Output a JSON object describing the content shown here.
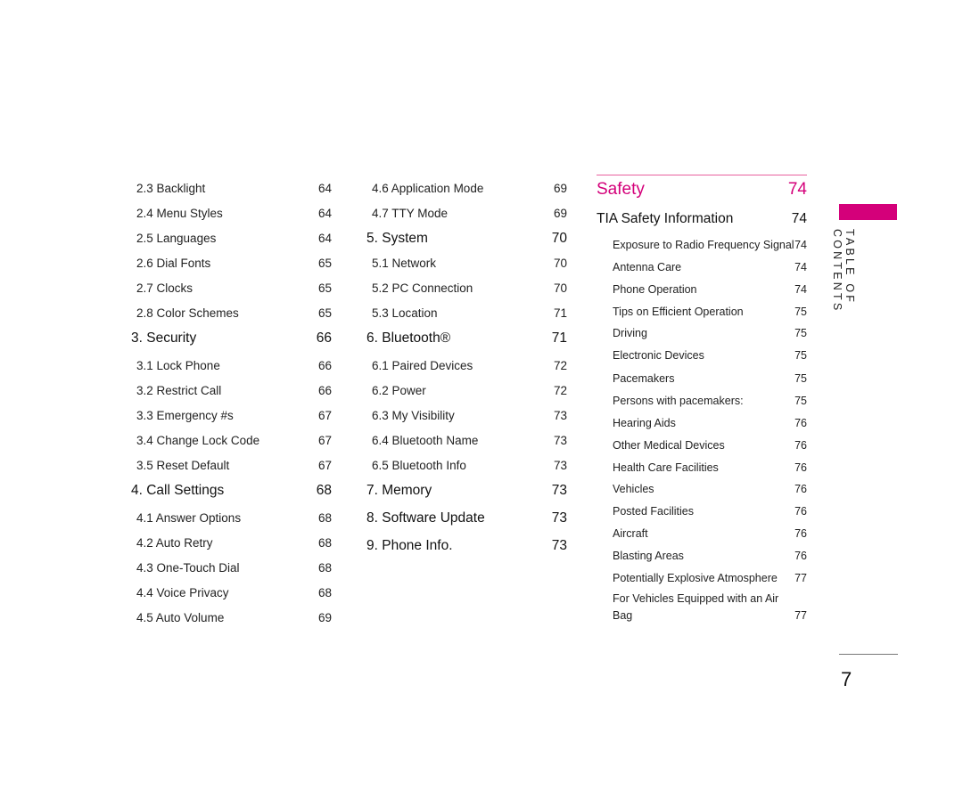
{
  "column1": [
    {
      "label": "2.3 Backlight",
      "page": "64",
      "level": "sub"
    },
    {
      "label": "2.4 Menu Styles",
      "page": "64",
      "level": "sub"
    },
    {
      "label": "2.5 Languages",
      "page": "64",
      "level": "sub"
    },
    {
      "label": "2.6 Dial Fonts",
      "page": "65",
      "level": "sub"
    },
    {
      "label": "2.7 Clocks",
      "page": "65",
      "level": "sub"
    },
    {
      "label": "2.8 Color Schemes",
      "page": "65",
      "level": "sub"
    },
    {
      "label": "3. Security",
      "page": "66",
      "level": "head"
    },
    {
      "label": "3.1 Lock Phone",
      "page": "66",
      "level": "sub"
    },
    {
      "label": "3.2 Restrict Call",
      "page": "66",
      "level": "sub"
    },
    {
      "label": "3.3 Emergency #s",
      "page": "67",
      "level": "sub"
    },
    {
      "label": "3.4 Change Lock Code",
      "page": "67",
      "level": "sub"
    },
    {
      "label": "3.5 Reset Default",
      "page": "67",
      "level": "sub"
    },
    {
      "label": "4. Call Settings",
      "page": "68",
      "level": "head"
    },
    {
      "label": "4.1 Answer Options",
      "page": "68",
      "level": "sub"
    },
    {
      "label": "4.2 Auto Retry",
      "page": "68",
      "level": "sub"
    },
    {
      "label": "4.3 One-Touch Dial",
      "page": "68",
      "level": "sub"
    },
    {
      "label": "4.4 Voice Privacy",
      "page": "68",
      "level": "sub"
    },
    {
      "label": "4.5 Auto Volume",
      "page": "69",
      "level": "sub"
    }
  ],
  "column2": [
    {
      "label": "4.6 Application Mode",
      "page": "69",
      "level": "sub"
    },
    {
      "label": "4.7 TTY Mode",
      "page": "69",
      "level": "sub"
    },
    {
      "label": "5. System",
      "page": "70",
      "level": "head"
    },
    {
      "label": "5.1 Network",
      "page": "70",
      "level": "sub"
    },
    {
      "label": "5.2 PC Connection",
      "page": "70",
      "level": "sub"
    },
    {
      "label": "5.3 Location",
      "page": "71",
      "level": "sub"
    },
    {
      "label": "6. Bluetooth®",
      "page": "71",
      "level": "head"
    },
    {
      "label": "6.1 Paired Devices",
      "page": "72",
      "level": "sub"
    },
    {
      "label": "6.2 Power",
      "page": "72",
      "level": "sub"
    },
    {
      "label": "6.3 My Visibility",
      "page": "73",
      "level": "sub"
    },
    {
      "label": "6.4 Bluetooth Name",
      "page": "73",
      "level": "sub"
    },
    {
      "label": "6.5 Bluetooth Info",
      "page": "73",
      "level": "sub"
    },
    {
      "label": "7. Memory",
      "page": "73",
      "level": "head"
    },
    {
      "label": "8. Software Update",
      "page": "73",
      "level": "head"
    },
    {
      "label": "9. Phone Info.",
      "page": "73",
      "level": "head"
    }
  ],
  "column3": {
    "section_title": "Safety",
    "section_page": "74",
    "heading": "TIA Safety Information",
    "heading_page": "74",
    "items": [
      {
        "label": "Exposure to Radio Frequency Signal",
        "page": "74"
      },
      {
        "label": "Antenna Care",
        "page": "74"
      },
      {
        "label": "Phone Operation",
        "page": "74"
      },
      {
        "label": "Tips on Efficient Operation",
        "page": "75"
      },
      {
        "label": "Driving",
        "page": "75"
      },
      {
        "label": "Electronic Devices",
        "page": "75"
      },
      {
        "label": "Pacemakers",
        "page": "75"
      },
      {
        "label": "Persons with pacemakers:",
        "page": "75"
      },
      {
        "label": "Hearing Aids",
        "page": "76"
      },
      {
        "label": "Other Medical Devices",
        "page": "76"
      },
      {
        "label": "Health Care Facilities",
        "page": "76"
      },
      {
        "label": "Vehicles",
        "page": "76"
      },
      {
        "label": "Posted Facilities",
        "page": "76"
      },
      {
        "label": "Aircraft",
        "page": "76"
      },
      {
        "label": "Blasting Areas",
        "page": "76"
      },
      {
        "label": "Potentially Explosive Atmosphere",
        "page": "77"
      }
    ],
    "last_item": {
      "line1": "For Vehicles Equipped with an Air",
      "line2": "Bag",
      "page": "77"
    }
  },
  "side_tab": {
    "label": "TABLE OF CONTENTS",
    "accent_color": "#d4007a"
  },
  "page_number": "7"
}
